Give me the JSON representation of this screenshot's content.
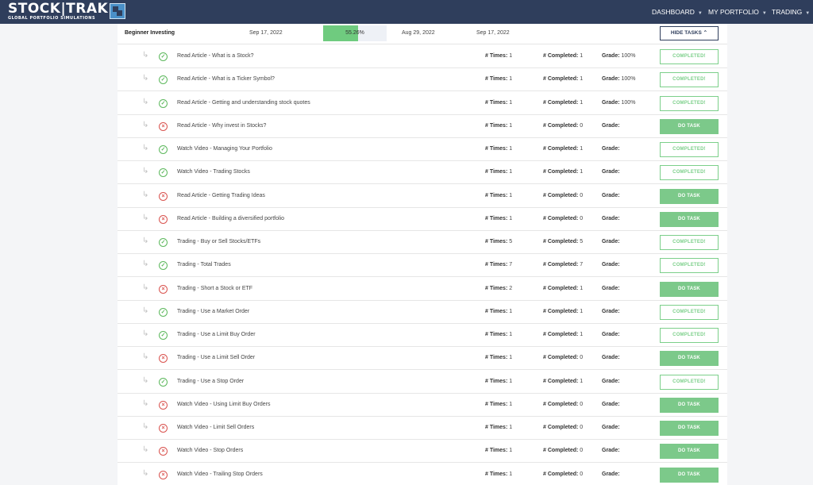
{
  "brand": {
    "name": "STOCK|TRAK",
    "tagline": "GLOBAL PORTFOLIO SIMULATIONS"
  },
  "nav": [
    {
      "label": "DASHBOARD"
    },
    {
      "label": "MY PORTFOLIO"
    },
    {
      "label": "TRADING"
    }
  ],
  "assignment": {
    "name": "Beginner Investing",
    "date_start": "Sep 17, 2022",
    "progress_text": "55.26%",
    "progress_value": 55.26,
    "date_due": "Aug 29, 2022",
    "date_end": "Sep 17, 2022",
    "hide_button": "HIDE TASKS",
    "hide_caret": "⌃"
  },
  "labels": {
    "times": "# Times:",
    "completed": "# Completed:",
    "grade": "Grade:"
  },
  "tasks": [
    {
      "name": "Read Article - What is a Stock?",
      "done": true,
      "times": "1",
      "completed": "1",
      "grade": "100%",
      "button": "COMPLETED!"
    },
    {
      "name": "Read Article - What is a Ticker Symbol?",
      "done": true,
      "times": "1",
      "completed": "1",
      "grade": "100%",
      "button": "COMPLETED!"
    },
    {
      "name": "Read Article - Getting and understanding stock quotes",
      "done": true,
      "times": "1",
      "completed": "1",
      "grade": "100%",
      "button": "COMPLETED!"
    },
    {
      "name": "Read Article - Why invest in Stocks?",
      "done": false,
      "times": "1",
      "completed": "0",
      "grade": "",
      "button": "DO TASK"
    },
    {
      "name": "Watch Video - Managing Your Portfolio",
      "done": true,
      "times": "1",
      "completed": "1",
      "grade": "",
      "button": "COMPLETED!"
    },
    {
      "name": "Watch Video - Trading Stocks",
      "done": true,
      "times": "1",
      "completed": "1",
      "grade": "",
      "button": "COMPLETED!"
    },
    {
      "name": "Read Article - Getting Trading Ideas",
      "done": false,
      "times": "1",
      "completed": "0",
      "grade": "",
      "button": "DO TASK"
    },
    {
      "name": "Read Article - Building a diversified portfolio",
      "done": false,
      "times": "1",
      "completed": "0",
      "grade": "",
      "button": "DO TASK"
    },
    {
      "name": "Trading - Buy or Sell Stocks/ETFs",
      "done": true,
      "times": "5",
      "completed": "5",
      "grade": "",
      "button": "COMPLETED!"
    },
    {
      "name": "Trading - Total Trades",
      "done": true,
      "times": "7",
      "completed": "7",
      "grade": "",
      "button": "COMPLETED!"
    },
    {
      "name": "Trading - Short a Stock or ETF",
      "done": false,
      "times": "2",
      "completed": "1",
      "grade": "",
      "button": "DO TASK"
    },
    {
      "name": "Trading - Use a Market Order",
      "done": true,
      "times": "1",
      "completed": "1",
      "grade": "",
      "button": "COMPLETED!"
    },
    {
      "name": "Trading - Use a Limit Buy Order",
      "done": true,
      "times": "1",
      "completed": "1",
      "grade": "",
      "button": "COMPLETED!"
    },
    {
      "name": "Trading - Use a Limit Sell Order",
      "done": false,
      "times": "1",
      "completed": "0",
      "grade": "",
      "button": "DO TASK"
    },
    {
      "name": "Trading - Use a Stop Order",
      "done": true,
      "times": "1",
      "completed": "1",
      "grade": "",
      "button": "COMPLETED!"
    },
    {
      "name": "Watch Video - Using Limit Buy Orders",
      "done": false,
      "times": "1",
      "completed": "0",
      "grade": "",
      "button": "DO TASK"
    },
    {
      "name": "Watch Video - Limit Sell Orders",
      "done": false,
      "times": "1",
      "completed": "0",
      "grade": "",
      "button": "DO TASK"
    },
    {
      "name": "Watch Video - Stop Orders",
      "done": false,
      "times": "1",
      "completed": "0",
      "grade": "",
      "button": "DO TASK"
    },
    {
      "name": "Watch Video - Trailing Stop Orders",
      "done": false,
      "times": "1",
      "completed": "0",
      "grade": "",
      "button": "DO TASK"
    }
  ],
  "colors": {
    "topbar": "#2f3e5c",
    "complete_green": "#5cb85c",
    "incomplete_red": "#d9534f",
    "do_task_green": "#7cc98a"
  }
}
